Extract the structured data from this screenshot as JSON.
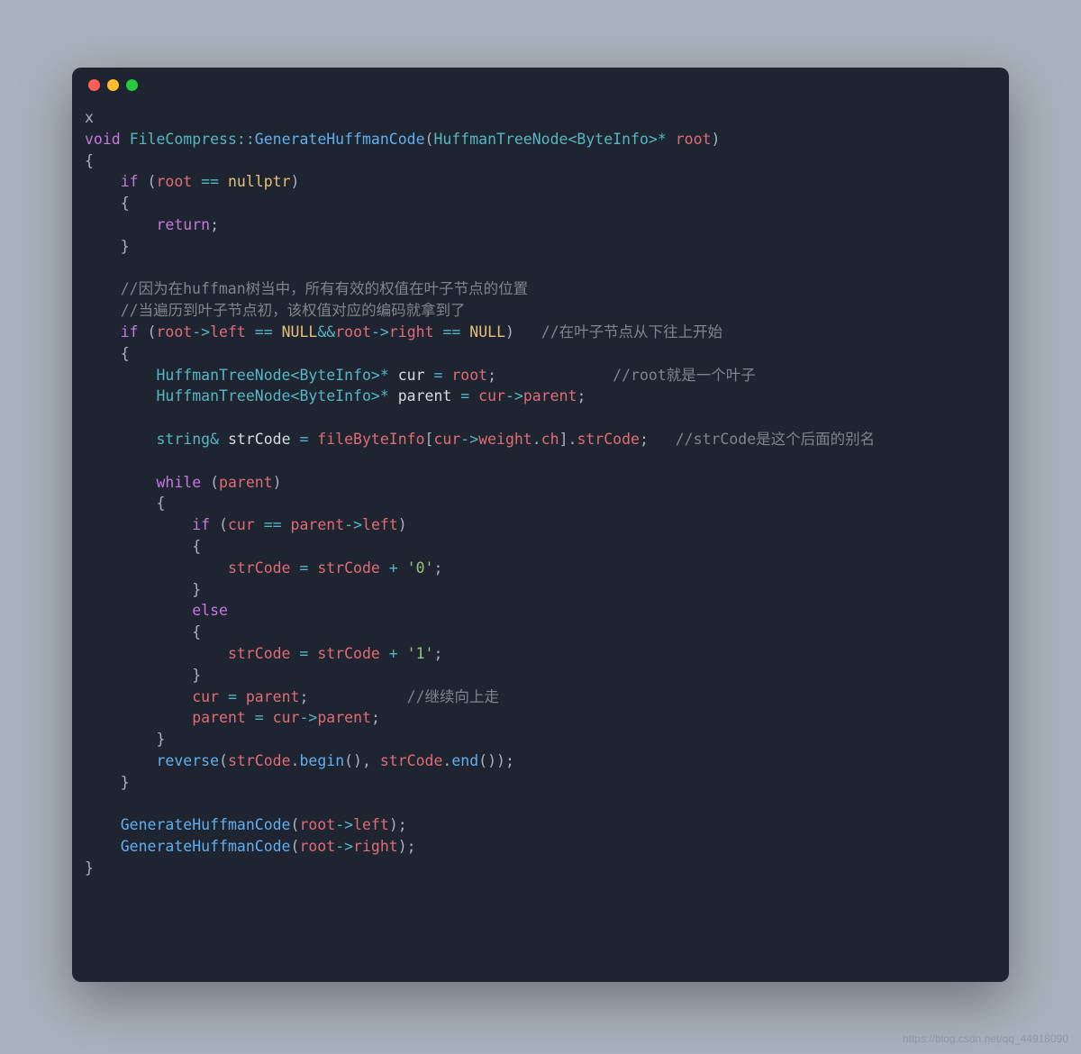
{
  "window": {
    "buttons": [
      "close",
      "minimize",
      "zoom"
    ],
    "lead_char": "x"
  },
  "code": {
    "l1": {
      "void": "void",
      "ns": "FileCompress",
      "cc": "::",
      "fn": "GenerateHuffmanCode",
      "lp": "(",
      "tn": "HuffmanTreeNode",
      "lt": "<",
      "ti": "ByteInfo",
      "gt": ">",
      "star": "*",
      "arg": " root",
      "rp": ")"
    },
    "l2": "{",
    "l3": {
      "if": "if",
      "lp": " (",
      "root": "root",
      "eq": " == ",
      "nullp": "nullptr",
      "rp": ")"
    },
    "l4": "    {",
    "l5": {
      "ret": "return",
      "sc": ";"
    },
    "l6": "    }",
    "c1": "//因为在huffman树当中，所有有效的权值在叶子节点的位置",
    "c2": "//当遍历到叶子节点初，该权值对应的编码就拿到了",
    "l7": {
      "if": "if",
      "lp": " (",
      "root": "root",
      "arr": "->",
      "left": "left",
      "eq": " == ",
      "NULL": "NULL",
      "amp": "&&",
      "root2": "root",
      "arr2": "->",
      "right": "right",
      "eq2": " == ",
      "NULL2": "NULL",
      "rp": ")   ",
      "cm": "//在叶子节点从下往上开始"
    },
    "l8": "    {",
    "l9": {
      "tn": "HuffmanTreeNode",
      "lt": "<",
      "ti": "ByteInfo",
      "gt": ">",
      "star": "*",
      "cur": " cur ",
      "asgn": "=",
      "root": " root",
      "sc": ";",
      "pad": "             ",
      "cm": "//root就是一个叶子"
    },
    "l10": {
      "tn": "HuffmanTreeNode",
      "lt": "<",
      "ti": "ByteInfo",
      "gt": ">",
      "star": "*",
      "par": " parent ",
      "asgn": "=",
      "cur": " cur",
      "arr": "->",
      "parent": "parent",
      "sc": ";"
    },
    "l11": {
      "ty": "string",
      "amp": "&",
      "id": " strCode ",
      "asgn": "=",
      "fbi": " fileByteInfo",
      "lb": "[",
      "cur": "cur",
      "arr": "->",
      "w": "weight",
      "dot": ".",
      "ch": "ch",
      "rb": "]",
      "dot2": ".",
      "sc2": "strCode",
      "semi": ";",
      "pad": "   ",
      "cm": "//strCode是这个后面的别名"
    },
    "l12": {
      "while": "while",
      "lp": " (",
      "par": "parent",
      "rp": ")"
    },
    "l13": "        {",
    "l14": {
      "if": "if",
      "lp": " (",
      "cur": "cur",
      "eq": " == ",
      "par": "parent",
      "arr": "->",
      "left": "left",
      "rp": ")"
    },
    "l15": "            {",
    "l16": {
      "a": "strCode",
      "eq": " = ",
      "b": "strCode",
      "plus": " + ",
      "lit": "'0'",
      "sc": ";"
    },
    "l17": "            }",
    "l18": {
      "else": "else"
    },
    "l19": "            {",
    "l20": {
      "a": "strCode",
      "eq": " = ",
      "b": "strCode",
      "plus": " + ",
      "lit": "'1'",
      "sc": ";"
    },
    "l21": "            }",
    "l22": {
      "cur": "cur",
      "eq": " = ",
      "par": "parent",
      "sc": ";",
      "pad": "           ",
      "cm": "//继续向上走"
    },
    "l23": {
      "par": "parent",
      "eq": " = ",
      "cur": "cur",
      "arr": "->",
      "parent": "parent",
      "sc": ";"
    },
    "l24": "        }",
    "l25": {
      "rev": "reverse",
      "lp": "(",
      "s1": "strCode",
      "dot": ".",
      "b": "begin",
      "p": "()",
      "comma": ", ",
      "s2": "strCode",
      "dot2": ".",
      "e": "end",
      "p2": "()",
      "rp": ")",
      "sc": ";"
    },
    "l26": "    }",
    "l27": {
      "fn": "GenerateHuffmanCode",
      "lp": "(",
      "root": "root",
      "arr": "->",
      "left": "left",
      "rp": ")",
      "sc": ";"
    },
    "l28": {
      "fn": "GenerateHuffmanCode",
      "lp": "(",
      "root": "root",
      "arr": "->",
      "right": "right",
      "rp": ")",
      "sc": ";"
    },
    "l29": "}"
  },
  "watermark": "https://blog.csdn.net/qq_44918090"
}
